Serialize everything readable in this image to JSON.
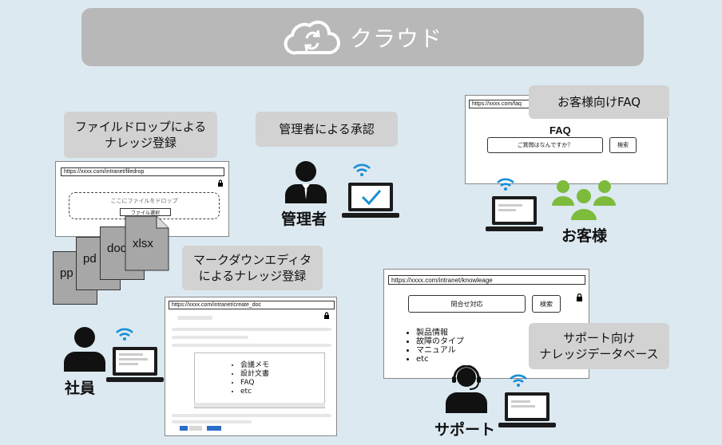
{
  "cloud": {
    "label": "クラウド",
    "icon": "cloud-sync-icon"
  },
  "file_drop": {
    "caption_line1": "ファイルドロップによる",
    "caption_line2": "ナレッジ登録",
    "url": "https://xxxx.com/intranet/filedrop",
    "drop_text": "ここにファイルをドロップ",
    "select_button": "ファイル選択",
    "files": [
      "pp",
      "pd",
      "doc",
      "xlsx"
    ]
  },
  "approval": {
    "caption": "管理者による承認",
    "role": "管理者"
  },
  "customer_faq": {
    "caption": "お客様向けFAQ",
    "url": "https://xxxx.com/faq",
    "heading": "FAQ",
    "placeholder": "ご質問はなんですか？",
    "search_button": "検索",
    "role": "お客様"
  },
  "markdown_editor": {
    "caption_line1": "マークダウンエディタ",
    "caption_line2": "によるナレッジ登録",
    "url": "https://xxxx.com/intranet/create_doc",
    "items": [
      "会議メモ",
      "設計文書",
      "FAQ",
      "etc"
    ],
    "role": "社員"
  },
  "support_kb": {
    "url": "https://xxxx.com/intranet/knowleage",
    "search_value": "問合せ対応",
    "search_button": "検索",
    "items": [
      "製品情報",
      "故障のタイプ",
      "マニュアル",
      "etc"
    ],
    "caption_line1": "サポート向け",
    "caption_line2": "ナレッジデータベース",
    "role": "サポート"
  },
  "colors": {
    "accent_blue": "#1a8fd6",
    "customer_green": "#7dbb3c",
    "laptop_dark": "#1b1b1b"
  }
}
